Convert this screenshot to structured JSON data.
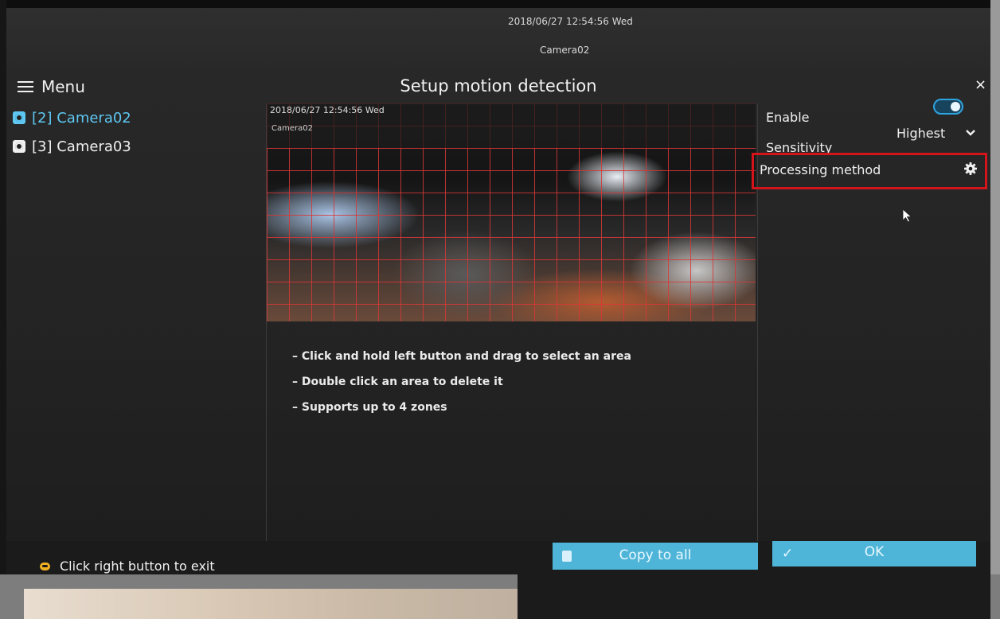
{
  "overlay": {
    "timestamp": "2018/06/27 12:54:56 Wed",
    "camera_name": "Camera02"
  },
  "header": {
    "menu_label": "Menu",
    "title": "Setup motion detection",
    "close_symbol": "×"
  },
  "sidebar": {
    "items": [
      {
        "label": "[2] Camera02",
        "selected": true,
        "color": "#5ec8f2"
      },
      {
        "label": "[3] Camera03",
        "selected": false,
        "color": "#f0f0f0"
      }
    ]
  },
  "preview": {
    "timestamp": "2018/06/27 12:54:56 Wed",
    "camera_name": "Camera02",
    "grid_color": "#d73737"
  },
  "instructions": [
    "– Click and hold left button and drag to select an area",
    "– Double click an area to delete it",
    "– Supports up to 4 zones"
  ],
  "settings": {
    "enable_label": "Enable",
    "enable_on": true,
    "sensitivity_label": "Sensitivity",
    "sensitivity_value": "Highest",
    "processing_label": "Processing method",
    "highlight_color": "#d4141b",
    "accent_color": "#2ea3e0"
  },
  "footer": {
    "status_text": "Click right button to exit",
    "copy_label": "Copy to all",
    "ok_label": "OK",
    "check_symbol": "✓",
    "button_color": "#4fb5d8"
  }
}
